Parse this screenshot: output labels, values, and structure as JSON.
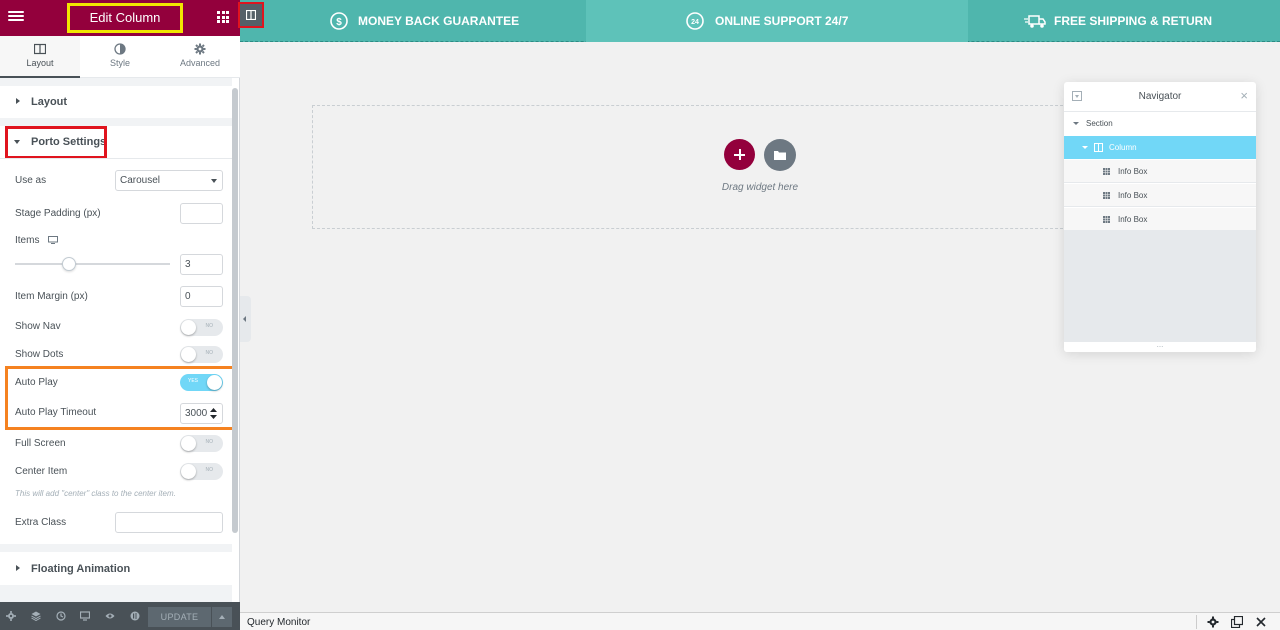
{
  "panel": {
    "header_title": "Edit Column",
    "tabs": [
      {
        "label": "Layout",
        "active": true
      },
      {
        "label": "Style",
        "active": false
      },
      {
        "label": "Advanced",
        "active": false
      }
    ],
    "sections": {
      "layout": "Layout",
      "porto": "Porto Settings",
      "floating": "Floating Animation"
    },
    "fields": {
      "use_as_label": "Use as",
      "use_as_value": "Carousel",
      "stage_padding_label": "Stage Padding (px)",
      "stage_padding_value": "",
      "items_label": "Items",
      "items_value": "3",
      "items_slider_fraction": 0.35,
      "item_margin_label": "Item Margin (px)",
      "item_margin_value": "0",
      "show_nav_label": "Show Nav",
      "show_nav_value": "NO",
      "show_dots_label": "Show Dots",
      "show_dots_value": "NO",
      "auto_play_label": "Auto Play",
      "auto_play_value": "YES",
      "auto_play_timeout_label": "Auto Play Timeout",
      "auto_play_timeout_value": "3000",
      "full_screen_label": "Full Screen",
      "full_screen_value": "NO",
      "center_item_label": "Center Item",
      "center_item_value": "NO",
      "center_item_help": "This will add \"center\" class to the center item.",
      "extra_class_label": "Extra Class",
      "extra_class_value": ""
    },
    "footer": {
      "update_label": "UPDATE",
      "icons": [
        "gear-icon",
        "layers-icon",
        "history-icon",
        "responsive-icon",
        "eye-icon",
        "elementor-icon"
      ]
    }
  },
  "topbar": {
    "items": [
      {
        "label": "MONEY BACK GUARANTEE",
        "icon": "dollar-icon"
      },
      {
        "label": "ONLINE SUPPORT 24/7",
        "icon": "support-24-icon"
      },
      {
        "label": "FREE SHIPPING & RETURN",
        "icon": "truck-icon"
      }
    ]
  },
  "canvas": {
    "drag_text": "Drag widget here"
  },
  "navigator": {
    "title": "Navigator",
    "items": [
      {
        "label": "Section",
        "type": "section"
      },
      {
        "label": "Column",
        "type": "column"
      },
      {
        "label": "Info Box",
        "type": "widget"
      },
      {
        "label": "Info Box",
        "type": "widget"
      },
      {
        "label": "Info Box",
        "type": "widget"
      }
    ],
    "resize_glyph": "..."
  },
  "query_monitor": {
    "label": "Query Monitor"
  },
  "colors": {
    "brand": "#93003c",
    "topbar": "#4fb6ad",
    "switch_on": "#71d7f7",
    "highlight_yellow": "#f2e500",
    "highlight_red": "#e0141e",
    "highlight_orange": "#f58220"
  }
}
